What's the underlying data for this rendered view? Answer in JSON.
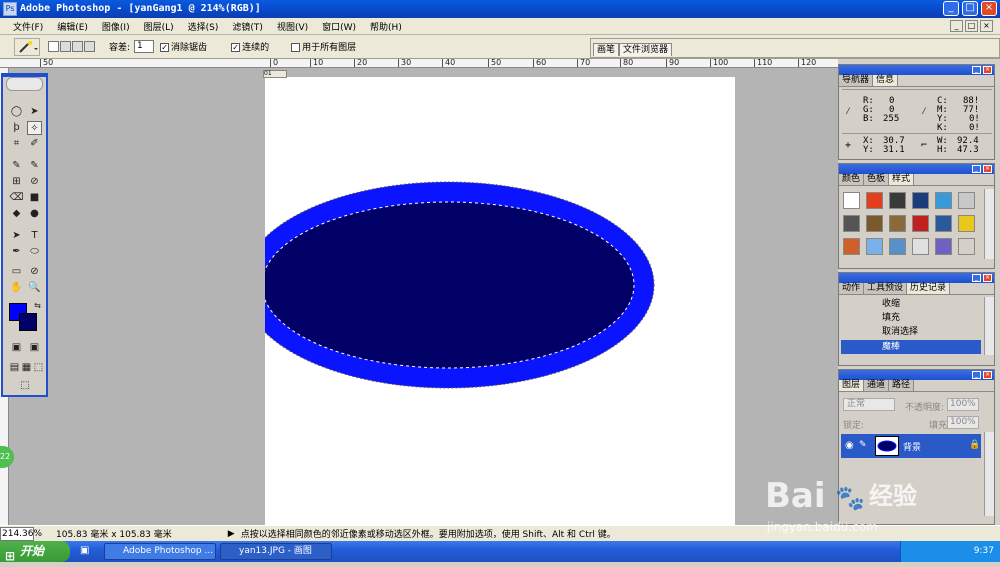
{
  "window": {
    "title": "Adobe Photoshop - [yanGang1 @ 214%(RGB)]",
    "logo_text": "Ps",
    "minimize_glyph": "_",
    "restore_glyph": "□",
    "close_glyph": "×"
  },
  "menu": {
    "items": [
      "文件(F)",
      "编辑(E)",
      "图像(I)",
      "图层(L)",
      "选择(S)",
      "滤镜(T)",
      "视图(V)",
      "窗口(W)",
      "帮助(H)"
    ]
  },
  "options": {
    "tolerance_label": "容差:",
    "tolerance_value": "1",
    "antialias_label": "消除锯齿",
    "antialias_checked": true,
    "contiguous_label": "连续的",
    "contiguous_checked": true,
    "all_layers_label": "用于所有图层",
    "all_layers_checked": false,
    "dock_tabs": [
      "画笔",
      "文件浏览器"
    ]
  },
  "ruler": {
    "top_marks": [
      "50",
      "0",
      "10",
      "20",
      "30",
      "40",
      "50",
      "60",
      "70",
      "80",
      "90",
      "100",
      "110",
      "120"
    ]
  },
  "toolbox": {
    "tools": [
      "◯",
      "➤",
      "ϸ",
      "✧",
      "⌗",
      "✐",
      "✎",
      "✎",
      "⊞",
      "⊘",
      "⌫",
      "■",
      "◆",
      "●",
      "➤",
      "T",
      "✒",
      "⬭",
      "▭",
      "⊘",
      "✋",
      "🔍",
      "",
      "",
      "▣",
      "▣",
      "▤",
      "▦",
      "⬚",
      "⬚"
    ],
    "foreground_color": "#0000ff",
    "background_color": "#000066"
  },
  "canvas": {
    "doc_label": "01",
    "outer_ellipse_color": "#0a14ff",
    "inner_ellipse_color": "#000066"
  },
  "navigator": {
    "tabs": [
      "导航器",
      "信息"
    ],
    "r_label": "R:",
    "r": "0",
    "g_label": "G:",
    "g": "0",
    "b_label": "B:",
    "b": "255",
    "c_label": "C:",
    "c": "88!",
    "m_label": "M:",
    "m": "77!",
    "y_label": "Y:",
    "y": "0!",
    "k_label": "K:",
    "k": "0!",
    "x_label": "X:",
    "x": "30.7",
    "y2_label": "Y:",
    "y2": "31.1",
    "w_label": "W:",
    "w": "92.4",
    "h_label": "H:",
    "h": "47.3"
  },
  "styles_panel": {
    "tabs": [
      "颜色",
      "色板",
      "样式"
    ],
    "swatch_colors": [
      "#ffffff",
      "#e2401c",
      "#3a3a3a",
      "#1a3c7c",
      "#3a9ad8",
      "#c8c8c8",
      "#555555",
      "#7a5a2a",
      "#8a6a3a",
      "#c02020",
      "#2a5a9a",
      "#e8c818",
      "#d0602a",
      "#7ab0e8",
      "#5a90c8",
      "#e0e0e0",
      "#7060c0",
      "#d4d0c8"
    ]
  },
  "history": {
    "tabs": [
      "动作",
      "工具预设",
      "历史记录"
    ],
    "items": [
      "收缩",
      "填充",
      "取消选择",
      "魔棒"
    ],
    "active_index": 3
  },
  "layers": {
    "tabs": [
      "图层",
      "通道",
      "路径"
    ],
    "blend_mode": "正常",
    "opacity_label": "不透明度:",
    "opacity": "100%",
    "lock_label": "锁定:",
    "fill_label": "填充:",
    "fill": "100%",
    "layer_name": "背景"
  },
  "status": {
    "zoom": "214.36%",
    "doc_size": "105.83 毫米 x 105.83 毫米",
    "hint": "点按以选择相同颜色的邻近像素或移动选区外框。要用附加选项，使用 Shift、Alt 和 Ctrl 键。"
  },
  "taskbar": {
    "start_label": "开始",
    "tasks": [
      "Adobe Photoshop ...",
      "yan13.JPG - 画图"
    ],
    "time": "9:37",
    "badge": "22"
  },
  "watermark": {
    "logo": "Bai",
    "brand": "经验",
    "url": "jingyan.baidu.com"
  }
}
